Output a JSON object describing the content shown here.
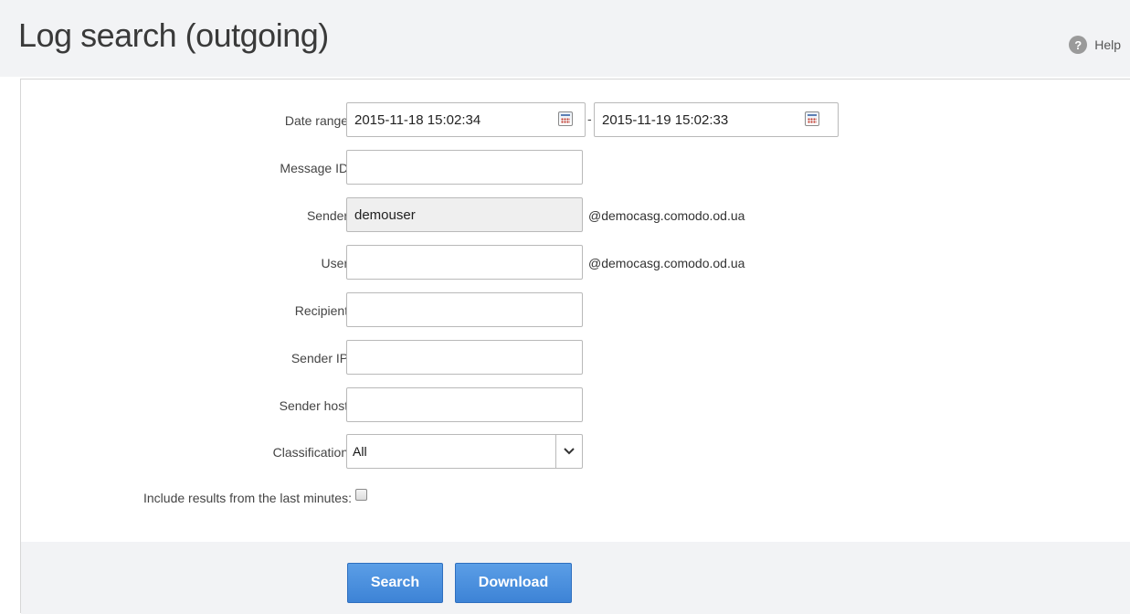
{
  "header": {
    "title": "Log search (outgoing)",
    "help_label": "Help",
    "help_icon": "help-circle-icon"
  },
  "form": {
    "date_range": {
      "label": "Date range:",
      "from": "2015-11-18 15:02:34",
      "separator": "-",
      "to": "2015-11-19 15:02:33",
      "icon": "calendar-icon"
    },
    "message_id": {
      "label": "Message ID:",
      "value": ""
    },
    "sender": {
      "label": "Sender:",
      "value": "demouser",
      "suffix": "@democasg.comodo.od.ua",
      "disabled": true
    },
    "user": {
      "label": "User:",
      "value": "",
      "suffix": "@democasg.comodo.od.ua"
    },
    "recipient": {
      "label": "Recipient:",
      "value": ""
    },
    "sender_ip": {
      "label": "Sender IP:",
      "value": ""
    },
    "sender_host": {
      "label": "Sender host:",
      "value": ""
    },
    "classification": {
      "label": "Classification:",
      "selected": "All"
    },
    "include_recent": {
      "label": "Include results from the last minutes:",
      "checked": false
    }
  },
  "actions": {
    "search_label": "Search",
    "download_label": "Download"
  },
  "colors": {
    "header_bg": "#f2f3f5",
    "button_blue": "#4a90e2",
    "disabled_input": "#efefef"
  }
}
